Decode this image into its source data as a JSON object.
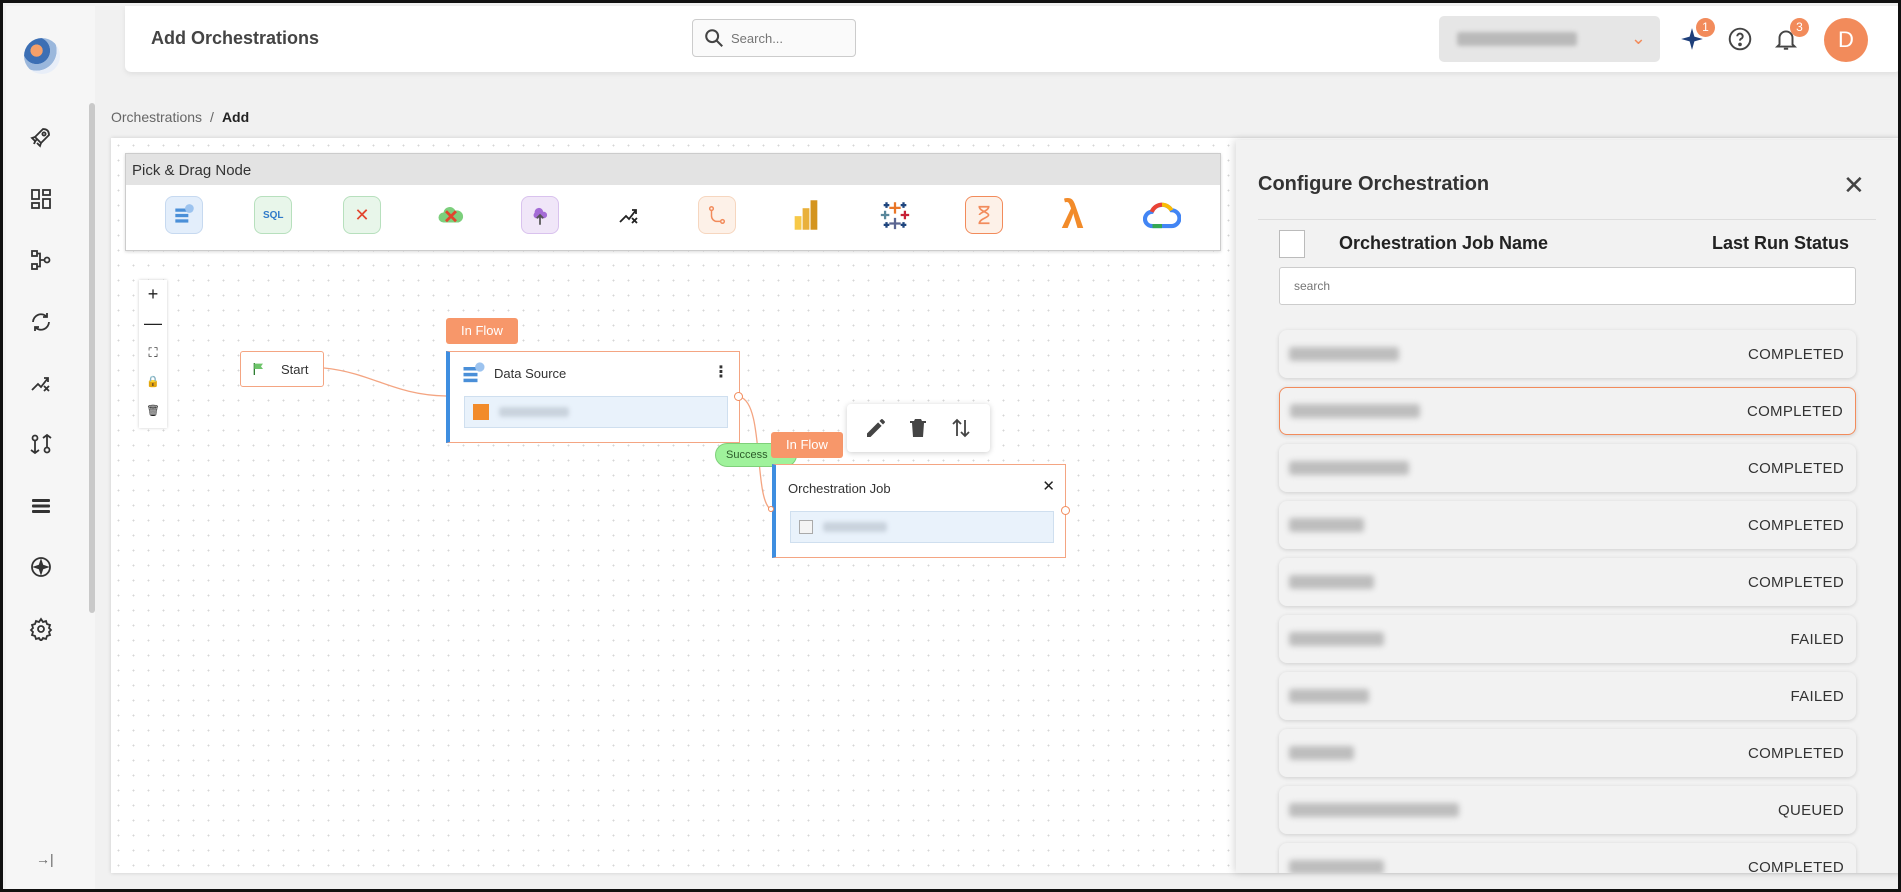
{
  "header": {
    "title": "Add Orchestrations",
    "search_placeholder": "Search...",
    "notifications": {
      "ai_badge": "1",
      "bell_badge": "3"
    },
    "avatar_initial": "D"
  },
  "breadcrumb": {
    "parent": "Orchestrations",
    "separator": "/",
    "current": "Add"
  },
  "palette": {
    "title": "Pick & Drag Node",
    "items": [
      {
        "icon": "data-source-icon"
      },
      {
        "icon": "sql-icon"
      },
      {
        "icon": "data-quality-icon"
      },
      {
        "icon": "cloud-cancel-icon"
      },
      {
        "icon": "upload-icon"
      },
      {
        "icon": "split-x-icon"
      },
      {
        "icon": "route-icon"
      },
      {
        "icon": "power-bi-icon"
      },
      {
        "icon": "tableau-icon"
      },
      {
        "icon": "hourglass-icon"
      },
      {
        "icon": "lambda-icon"
      },
      {
        "icon": "google-cloud-icon"
      }
    ]
  },
  "zoom_controls": {
    "zoom_in": "+",
    "zoom_out": "—",
    "fit": "⛶",
    "lock": "🔒",
    "delete": "🗑"
  },
  "flow": {
    "start_label": "Start",
    "inflow_label": "In Flow",
    "data_source_title": "Data Source",
    "success_label": "Success",
    "orchestration_job_title": "Orchestration Job"
  },
  "panel": {
    "title": "Configure Orchestration",
    "col_name": "Orchestration Job Name",
    "col_status": "Last Run Status",
    "search_placeholder": "search",
    "jobs": [
      {
        "status": "COMPLETED",
        "selected": false
      },
      {
        "status": "COMPLETED",
        "selected": true
      },
      {
        "status": "COMPLETED",
        "selected": false
      },
      {
        "status": "COMPLETED",
        "selected": false
      },
      {
        "status": "COMPLETED",
        "selected": false
      },
      {
        "status": "FAILED",
        "selected": false
      },
      {
        "status": "FAILED",
        "selected": false
      },
      {
        "status": "COMPLETED",
        "selected": false
      },
      {
        "status": "QUEUED",
        "selected": false
      },
      {
        "status": "COMPLETED",
        "selected": false
      }
    ]
  },
  "colors": {
    "accent": "#f28b5b",
    "node_border": "#3e8ee0",
    "success": "#9ff29b"
  }
}
